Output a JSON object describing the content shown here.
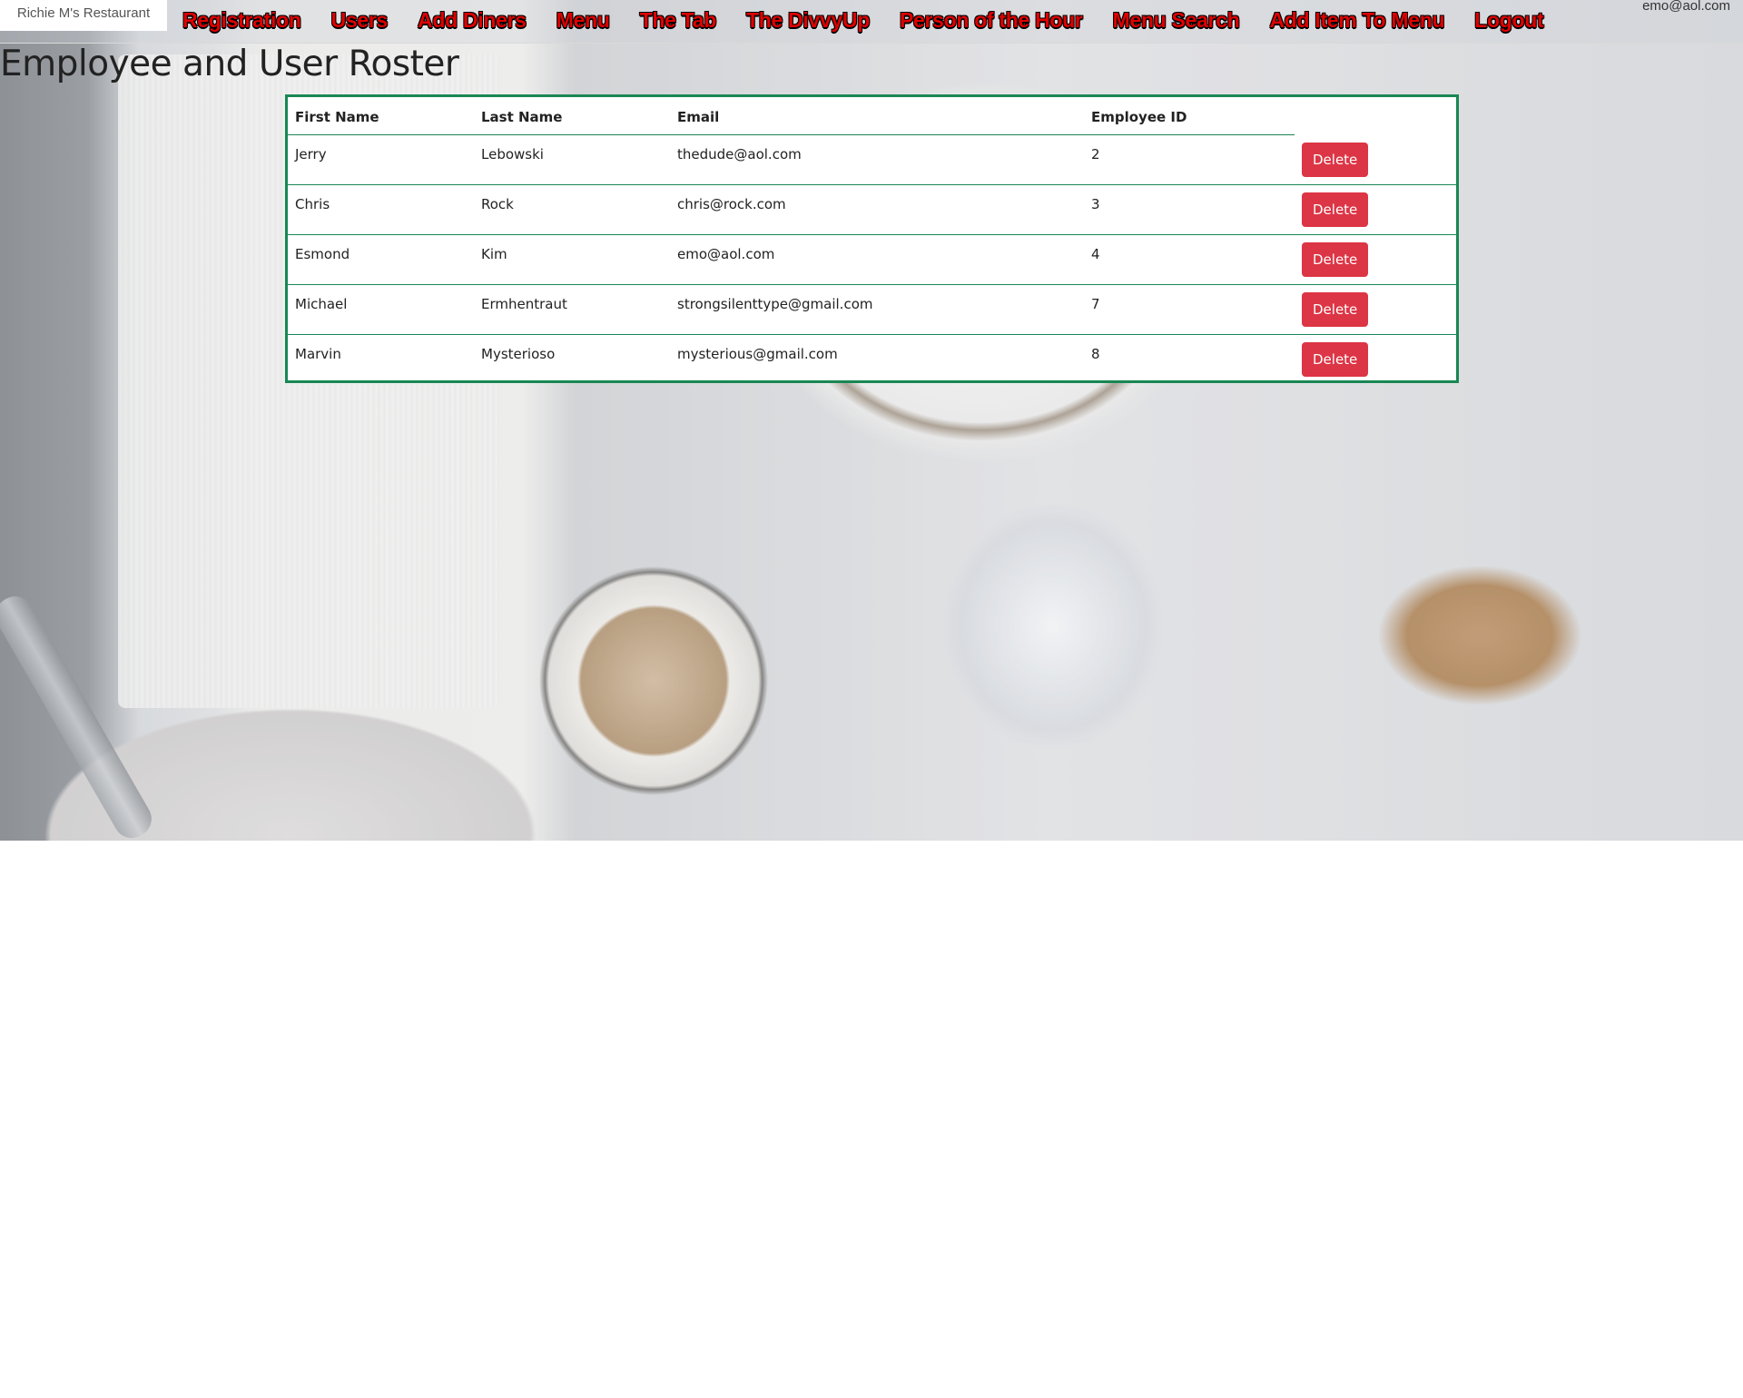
{
  "nav": {
    "brand": "Richie M's Restaurant",
    "links": [
      "Registration",
      "Users",
      "Add Diners",
      "Menu",
      "The Tab",
      "The DivvyUp",
      "Person of the Hour",
      "Menu Search",
      "Add Item To Menu",
      "Logout"
    ],
    "user_email": "emo@aol.com"
  },
  "page": {
    "title": "Employee and User Roster"
  },
  "table": {
    "headers": [
      "First Name",
      "Last Name",
      "Email",
      "Employee ID"
    ],
    "delete_label": "Delete",
    "rows": [
      {
        "first": "Jerry",
        "last": "Lebowski",
        "email": "thedude@aol.com",
        "id": "2"
      },
      {
        "first": "Chris",
        "last": "Rock",
        "email": "chris@rock.com",
        "id": "3"
      },
      {
        "first": "Esmond",
        "last": "Kim",
        "email": "emo@aol.com",
        "id": "4"
      },
      {
        "first": "Michael",
        "last": "Ermhentraut",
        "email": "strongsilenttype@gmail.com",
        "id": "7"
      },
      {
        "first": "Marvin",
        "last": "Mysterioso",
        "email": "mysterious@gmail.com",
        "id": "8"
      }
    ]
  },
  "colors": {
    "nav_link": "#e00000",
    "table_border": "#198754",
    "delete_button": "#dc3545"
  }
}
